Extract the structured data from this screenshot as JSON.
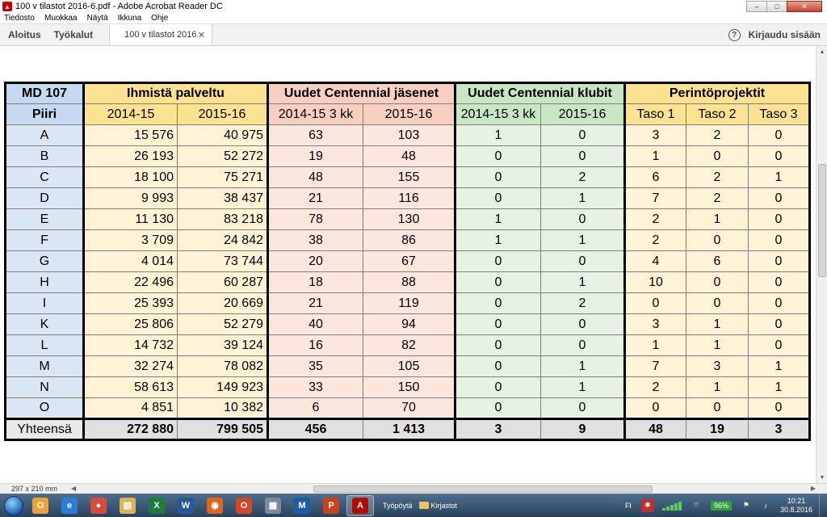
{
  "window": {
    "title": "100 v tilastot 2016-6.pdf - Adobe Acrobat Reader DC",
    "minimize": "–",
    "maximize": "□",
    "close": "✕"
  },
  "menu": [
    "Tiedosto",
    "Muokkaa",
    "Näytä",
    "Ikkuna",
    "Ohje"
  ],
  "tabs": {
    "home": "Aloitus",
    "tools": "Työkalut",
    "document": "100 v tilastot 2016...",
    "signin": "Kirjaudu sisään"
  },
  "table": {
    "region_label": "MD 107",
    "district_label": "Piiri",
    "groups": [
      "Ihmistä palveltu",
      "Uudet Centennial jäsenet",
      "Uudet Centennial klubit",
      "Perintöprojektit"
    ],
    "subheaders": [
      "2014-15",
      "2015-16",
      "2014-15 3 kk",
      "2015-16",
      "2014-15 3 kk",
      "2015-16",
      "Taso 1",
      "Taso 2",
      "Taso 3"
    ],
    "rows": [
      [
        "A",
        "15 576",
        "40 975",
        "63",
        "103",
        "1",
        "0",
        "3",
        "2",
        "0"
      ],
      [
        "B",
        "26 193",
        "52 272",
        "19",
        "48",
        "0",
        "0",
        "1",
        "0",
        "0"
      ],
      [
        "C",
        "18 100",
        "75 271",
        "48",
        "155",
        "0",
        "2",
        "6",
        "2",
        "1"
      ],
      [
        "D",
        "9 993",
        "38 437",
        "21",
        "116",
        "0",
        "1",
        "7",
        "2",
        "0"
      ],
      [
        "E",
        "11 130",
        "83 218",
        "78",
        "130",
        "1",
        "0",
        "2",
        "1",
        "0"
      ],
      [
        "F",
        "3 709",
        "24 842",
        "38",
        "86",
        "1",
        "1",
        "2",
        "0",
        "0"
      ],
      [
        "G",
        "4 014",
        "73 744",
        "20",
        "67",
        "0",
        "0",
        "4",
        "6",
        "0"
      ],
      [
        "H",
        "22 496",
        "60 287",
        "18",
        "88",
        "0",
        "1",
        "10",
        "0",
        "0"
      ],
      [
        "I",
        "25 393",
        "20 669",
        "21",
        "119",
        "0",
        "2",
        "0",
        "0",
        "0"
      ],
      [
        "K",
        "25 806",
        "52 279",
        "40",
        "94",
        "0",
        "0",
        "3",
        "1",
        "0"
      ],
      [
        "L",
        "14 732",
        "39 124",
        "16",
        "82",
        "0",
        "0",
        "1",
        "1",
        "0"
      ],
      [
        "M",
        "32 274",
        "78 082",
        "35",
        "105",
        "0",
        "1",
        "7",
        "3",
        "1"
      ],
      [
        "N",
        "58 613",
        "149 923",
        "33",
        "150",
        "0",
        "1",
        "2",
        "1",
        "1"
      ],
      [
        "O",
        "4 851",
        "10 382",
        "6",
        "70",
        "0",
        "0",
        "0",
        "0",
        "0"
      ]
    ],
    "total": [
      "Yhteensä",
      "272 880",
      "799 505",
      "456",
      "1 413",
      "3",
      "9",
      "48",
      "19",
      "3"
    ]
  },
  "status": {
    "page_size": "297 x 210 mm"
  },
  "taskbar": {
    "apps": [
      {
        "name": "outlook-app",
        "glyph": "O",
        "color": "#e8a33a"
      },
      {
        "name": "ie-app",
        "glyph": "e",
        "color": "#2a7fd4"
      },
      {
        "name": "chrome-app",
        "glyph": "●",
        "color": "#d64b3a"
      },
      {
        "name": "explorer-app",
        "glyph": "▤",
        "color": "#d9b65a"
      },
      {
        "name": "excel-app",
        "glyph": "X",
        "color": "#1f7a3c"
      },
      {
        "name": "word-app",
        "glyph": "W",
        "color": "#2b5797"
      },
      {
        "name": "firefox-app",
        "glyph": "◉",
        "color": "#e0661f"
      },
      {
        "name": "office-app",
        "glyph": "O",
        "color": "#d24726"
      },
      {
        "name": "calculator-app",
        "glyph": "▦",
        "color": "#7d8a99"
      },
      {
        "name": "mail-app",
        "glyph": "M",
        "color": "#1e5aa8"
      },
      {
        "name": "powerpoint-app",
        "glyph": "P",
        "color": "#c9421c"
      },
      {
        "name": "acrobat-app",
        "glyph": "A",
        "color": "#b30b00"
      }
    ],
    "desktop": "Työpöytä",
    "folder": "Kirjastot",
    "lang": "FI",
    "battery": "96%",
    "time": "10:21",
    "date": "30.8.2016"
  }
}
